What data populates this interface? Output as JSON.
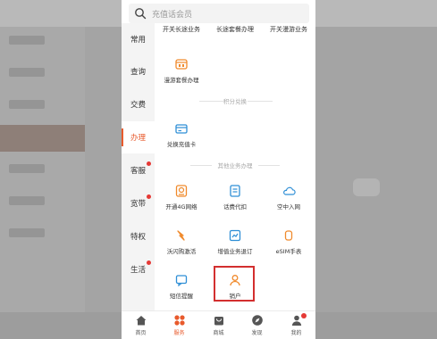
{
  "search": {
    "placeholder": "充值话会员"
  },
  "categories": [
    {
      "label": "常用",
      "active": false,
      "dot": false
    },
    {
      "label": "查询",
      "active": false,
      "dot": false
    },
    {
      "label": "交费",
      "active": false,
      "dot": false
    },
    {
      "label": "办理",
      "active": true,
      "dot": false
    },
    {
      "label": "客服",
      "active": false,
      "dot": true
    },
    {
      "label": "宽带",
      "active": false,
      "dot": true
    },
    {
      "label": "特权",
      "active": false,
      "dot": false
    },
    {
      "label": "生活",
      "active": false,
      "dot": true
    }
  ],
  "top_row": [
    "开关长途业务",
    "长途套餐办理",
    "开关漫游业务"
  ],
  "items": {
    "roaming_package": "漫游套餐办理",
    "redeem_card": "兑换充值卡",
    "open_4g": "开通4G网络",
    "fee_proxy": "话费代扣",
    "airborne": "空中入网",
    "flash_sms": "沃闪购激活",
    "value_added": "增值业务退订",
    "esim_watch": "eSIM手表",
    "sms_reminder": "短信提醒",
    "cancel_account": "销户"
  },
  "sections": {
    "points": "积分兑换",
    "other": "其他业务办理"
  },
  "tabbar": [
    {
      "label": "首页",
      "icon": "home-icon",
      "active": false
    },
    {
      "label": "服务",
      "icon": "service-icon",
      "active": true
    },
    {
      "label": "商城",
      "icon": "mall-icon",
      "active": false
    },
    {
      "label": "发现",
      "icon": "discover-icon",
      "active": false
    },
    {
      "label": "我的",
      "icon": "profile-icon",
      "active": false,
      "badge": true
    }
  ],
  "colors": {
    "accent": "#e85a2c",
    "highlight_box": "#d32f2f",
    "icon_blue": "#2f8fd6",
    "icon_orange": "#f08a2c"
  }
}
